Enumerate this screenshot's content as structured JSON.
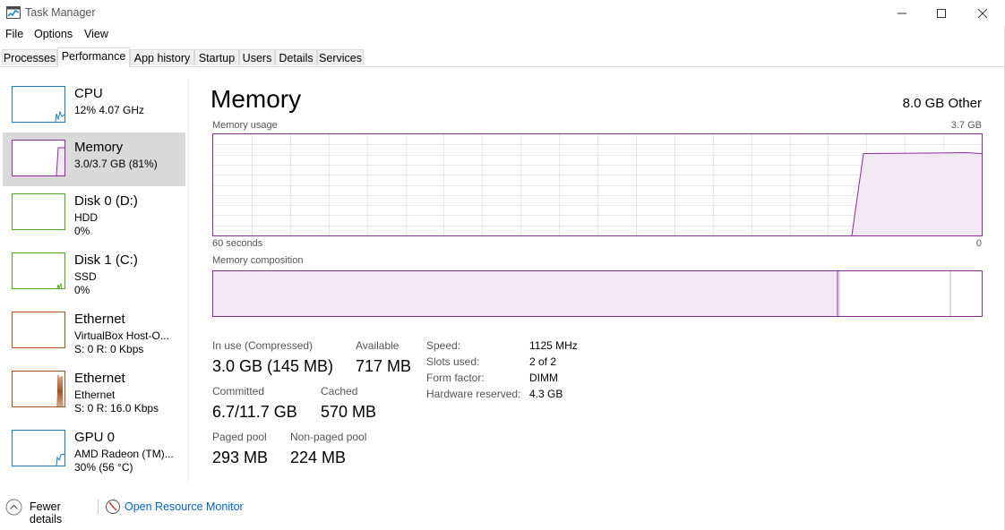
{
  "window": {
    "title": "Task Manager"
  },
  "menu": [
    "File",
    "Options",
    "View"
  ],
  "tabs": [
    "Processes",
    "Performance",
    "App history",
    "Startup",
    "Users",
    "Details",
    "Services"
  ],
  "active_tab": "Performance",
  "sidebar": [
    {
      "name": "CPU",
      "sub1": "12% 4.07 GHz",
      "sub2": "",
      "color": "#1a7dc4"
    },
    {
      "name": "Memory",
      "sub1": "3.0/3.7 GB (81%)",
      "sub2": "",
      "color": "#8b2c9a",
      "selected": true
    },
    {
      "name": "Disk 0 (D:)",
      "sub1": "HDD",
      "sub2": "0%",
      "color": "#4ca81e"
    },
    {
      "name": "Disk 1 (C:)",
      "sub1": "SSD",
      "sub2": "0%",
      "color": "#4ca81e"
    },
    {
      "name": "Ethernet",
      "sub1": "VirtualBox Host-O...",
      "sub2": "S: 0 R: 0 Kbps",
      "color": "#a7521a"
    },
    {
      "name": "Ethernet",
      "sub1": "Ethernet",
      "sub2": "S: 0 R: 16.0 Kbps",
      "color": "#a7521a"
    },
    {
      "name": "GPU 0",
      "sub1": "AMD Radeon (TM)...",
      "sub2": "30% (56 °C)",
      "color": "#1a7dc4"
    }
  ],
  "main": {
    "title": "Memory",
    "subtitle": "8.0 GB Other",
    "usage_label": "Memory usage",
    "usage_max": "3.7 GB",
    "time_left": "60 seconds",
    "time_right": "0",
    "composition_label": "Memory composition",
    "accent": "#8b2c9a",
    "usage_fraction": 0.81,
    "stats": {
      "in_use_label": "In use (Compressed)",
      "in_use_value": "3.0 GB (145 MB)",
      "available_label": "Available",
      "available_value": "717 MB",
      "committed_label": "Committed",
      "committed_value": "6.7/11.7 GB",
      "cached_label": "Cached",
      "cached_value": "570 MB",
      "paged_label": "Paged pool",
      "paged_value": "293 MB",
      "nonpaged_label": "Non-paged pool",
      "nonpaged_value": "224 MB"
    },
    "details": [
      {
        "label": "Speed:",
        "value": "1125 MHz"
      },
      {
        "label": "Slots used:",
        "value": "2 of 2"
      },
      {
        "label": "Form factor:",
        "value": "DIMM"
      },
      {
        "label": "Hardware reserved:",
        "value": "4.3 GB"
      }
    ]
  },
  "footer": {
    "fewer_details": "Fewer details",
    "open_resource_monitor": "Open Resource Monitor",
    "link_color": "#0066cc"
  }
}
